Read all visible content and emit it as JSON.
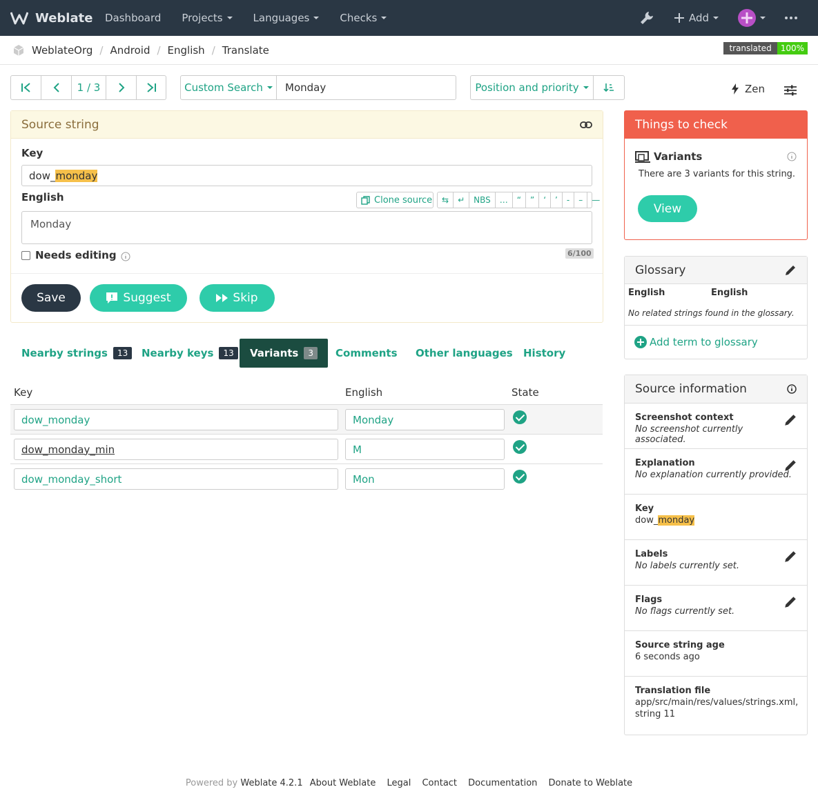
{
  "nav": {
    "brand": "Weblate",
    "items": [
      "Dashboard",
      "Projects",
      "Languages",
      "Checks"
    ],
    "add_label": "Add"
  },
  "breadcrumb": {
    "items": [
      "WeblateOrg",
      "Android",
      "English",
      "Translate"
    ],
    "badge_label": "translated",
    "badge_value": "100%"
  },
  "toolbar": {
    "position": "1 / 3",
    "search_type": "Custom Search",
    "search_value": "Monday",
    "sort_label": "Position and priority",
    "zen_label": "Zen"
  },
  "source": {
    "heading": "Source string",
    "key_label": "Key",
    "key_prefix": "dow_",
    "key_highlight": "monday",
    "lang_label": "English",
    "clone_label": "Clone source",
    "specials": [
      "⇆",
      "↵",
      "NBS",
      "…",
      "“",
      "”",
      "‘",
      "’",
      "-",
      "–",
      "—"
    ],
    "text": "Monday",
    "needs_editing": "Needs editing",
    "counter": "6/100",
    "save": "Save",
    "suggest": "Suggest",
    "skip": "Skip"
  },
  "tabs": [
    {
      "label": "Nearby strings",
      "count": "13"
    },
    {
      "label": "Nearby keys",
      "count": "13"
    },
    {
      "label": "Variants",
      "count": "3"
    },
    {
      "label": "Comments"
    },
    {
      "label": "Other languages"
    },
    {
      "label": "History"
    }
  ],
  "variants": {
    "headers": [
      "Key",
      "English",
      "State"
    ],
    "rows": [
      {
        "key": "dow_monday",
        "english": "Monday",
        "state": "translated"
      },
      {
        "key": "dow_monday_min",
        "english": "M",
        "state": "translated"
      },
      {
        "key": "dow_monday_short",
        "english": "Mon",
        "state": "translated"
      }
    ]
  },
  "checks": {
    "heading": "Things to check",
    "title": "Variants",
    "desc": "There are 3 variants for this string.",
    "button": "View"
  },
  "glossary": {
    "heading": "Glossary",
    "col1": "English",
    "col2": "English",
    "empty": "No related strings found in the glossary.",
    "add": "Add term to glossary"
  },
  "source_info": {
    "heading": "Source information",
    "screenshot_title": "Screenshot context",
    "screenshot_val": "No screenshot currently associated.",
    "explanation_title": "Explanation",
    "explanation_val": "No explanation currently provided.",
    "key_title": "Key",
    "key_prefix": "dow_",
    "key_highlight": "monday",
    "labels_title": "Labels",
    "labels_val": "No labels currently set.",
    "flags_title": "Flags",
    "flags_val": "No flags currently set.",
    "age_title": "Source string age",
    "age_val": "6 seconds ago",
    "file_title": "Translation file",
    "file_val1": "app/src/main/res/values/strings.xml,",
    "file_val2": "string 11"
  },
  "footer": {
    "powered": "Powered by",
    "version": "Weblate 4.2.1",
    "links": [
      "About Weblate",
      "Legal",
      "Contact",
      "Documentation",
      "Donate to Weblate"
    ]
  },
  "colors": {
    "accent": "#1fa385",
    "navbar": "#2a3744",
    "danger": "#f0604c",
    "active_tab": "#1b4c40"
  }
}
